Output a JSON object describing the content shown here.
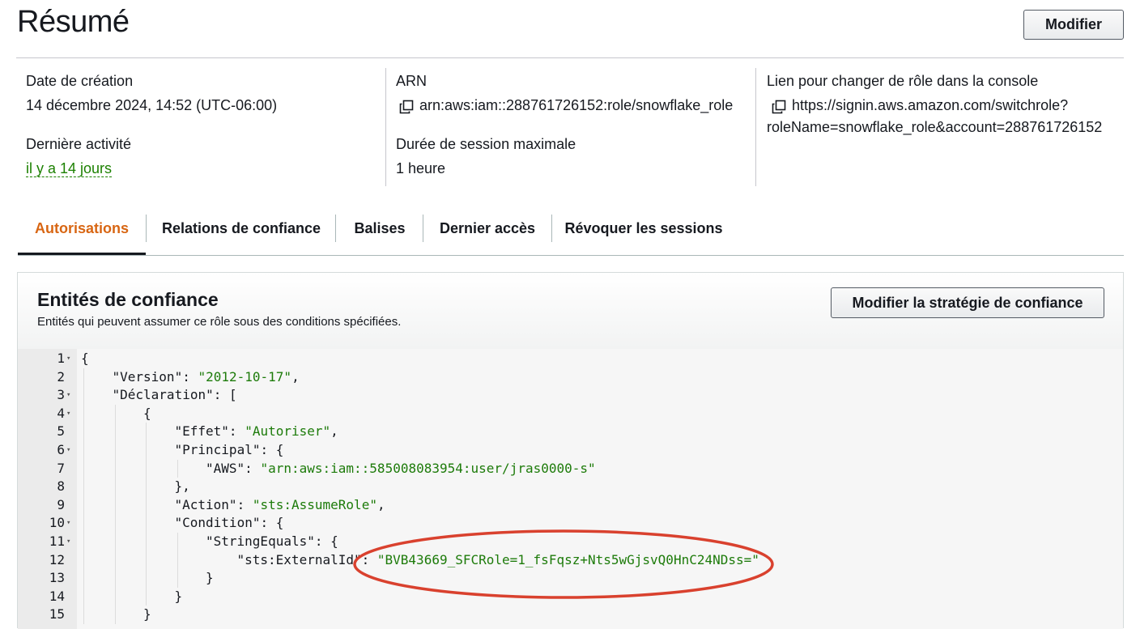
{
  "header": {
    "title": "Résumé",
    "modify_label": "Modifier"
  },
  "summary": {
    "creation_label": "Date de création",
    "creation_value": "14 décembre 2024, 14:52 (UTC-06:00)",
    "last_activity_label": "Dernière activité",
    "last_activity_value": "il y a 14 jours",
    "arn_label": "ARN",
    "arn_value": "arn:aws:iam::288761726152:role/snowflake_role",
    "session_label": "Durée de session maximale",
    "session_value": "1 heure",
    "console_link_label": "Lien pour changer de rôle dans la console",
    "console_link_line1": "https://signin.aws.amazon.com/switchrole?",
    "console_link_line2": "roleName=snowflake_role&account=288761726152"
  },
  "tabs": [
    {
      "label": "Autorisations",
      "active": true
    },
    {
      "label": "Relations de confiance",
      "active": false
    },
    {
      "label": "Balises",
      "active": false
    },
    {
      "label": "Dernier accès",
      "active": false
    },
    {
      "label": "Révoquer les sessions",
      "active": false
    }
  ],
  "trust_panel": {
    "title": "Entités de confiance",
    "description": "Entités qui peuvent assumer ce rôle sous des conditions spécifiées.",
    "edit_label": "Modifier la stratégie de confiance"
  },
  "policy_lines": [
    {
      "n": "1",
      "fold": true,
      "indent": 0,
      "parts": [
        [
          "p",
          "{"
        ]
      ]
    },
    {
      "n": "2",
      "fold": false,
      "indent": 1,
      "parts": [
        [
          "p",
          "\"Version\": "
        ],
        [
          "s",
          "\"2012-10-17\""
        ],
        [
          "p",
          ","
        ]
      ]
    },
    {
      "n": "3",
      "fold": true,
      "indent": 1,
      "parts": [
        [
          "p",
          "\"Déclaration\": ["
        ]
      ]
    },
    {
      "n": "4",
      "fold": true,
      "indent": 2,
      "parts": [
        [
          "p",
          "{"
        ]
      ]
    },
    {
      "n": "5",
      "fold": false,
      "indent": 3,
      "parts": [
        [
          "p",
          "\"Effet\": "
        ],
        [
          "s",
          "\"Autoriser\""
        ],
        [
          "p",
          ","
        ]
      ]
    },
    {
      "n": "6",
      "fold": true,
      "indent": 3,
      "parts": [
        [
          "p",
          "\"Principal\": {"
        ]
      ]
    },
    {
      "n": "7",
      "fold": false,
      "indent": 4,
      "parts": [
        [
          "p",
          "\"AWS\": "
        ],
        [
          "s",
          "\"arn:aws:iam::585008083954:user/jras0000-s\""
        ]
      ]
    },
    {
      "n": "8",
      "fold": false,
      "indent": 3,
      "parts": [
        [
          "p",
          "},"
        ]
      ]
    },
    {
      "n": "9",
      "fold": false,
      "indent": 3,
      "parts": [
        [
          "p",
          "\"Action\": "
        ],
        [
          "s",
          "\"sts:AssumeRole\""
        ],
        [
          "p",
          ","
        ]
      ]
    },
    {
      "n": "10",
      "fold": true,
      "indent": 3,
      "parts": [
        [
          "p",
          "\"Condition\": {"
        ]
      ]
    },
    {
      "n": "11",
      "fold": true,
      "indent": 4,
      "parts": [
        [
          "p",
          "\"StringEquals\": {"
        ]
      ]
    },
    {
      "n": "12",
      "fold": false,
      "indent": 5,
      "parts": [
        [
          "p",
          "\"sts:ExternalId\": "
        ],
        [
          "s",
          "\"BVB43669_SFCRole=1_fsFqsz+Nts5wGjsvQ0HnC24NDss=\""
        ]
      ]
    },
    {
      "n": "13",
      "fold": false,
      "indent": 4,
      "parts": [
        [
          "p",
          "}"
        ]
      ]
    },
    {
      "n": "14",
      "fold": false,
      "indent": 3,
      "parts": [
        [
          "p",
          "}"
        ]
      ]
    },
    {
      "n": "15",
      "fold": false,
      "indent": 2,
      "parts": [
        [
          "p",
          "}"
        ]
      ]
    }
  ],
  "colors": {
    "accent_tab": "#d86613",
    "string_green": "#1d7b0a",
    "highlight_oval": "#d9412e"
  }
}
